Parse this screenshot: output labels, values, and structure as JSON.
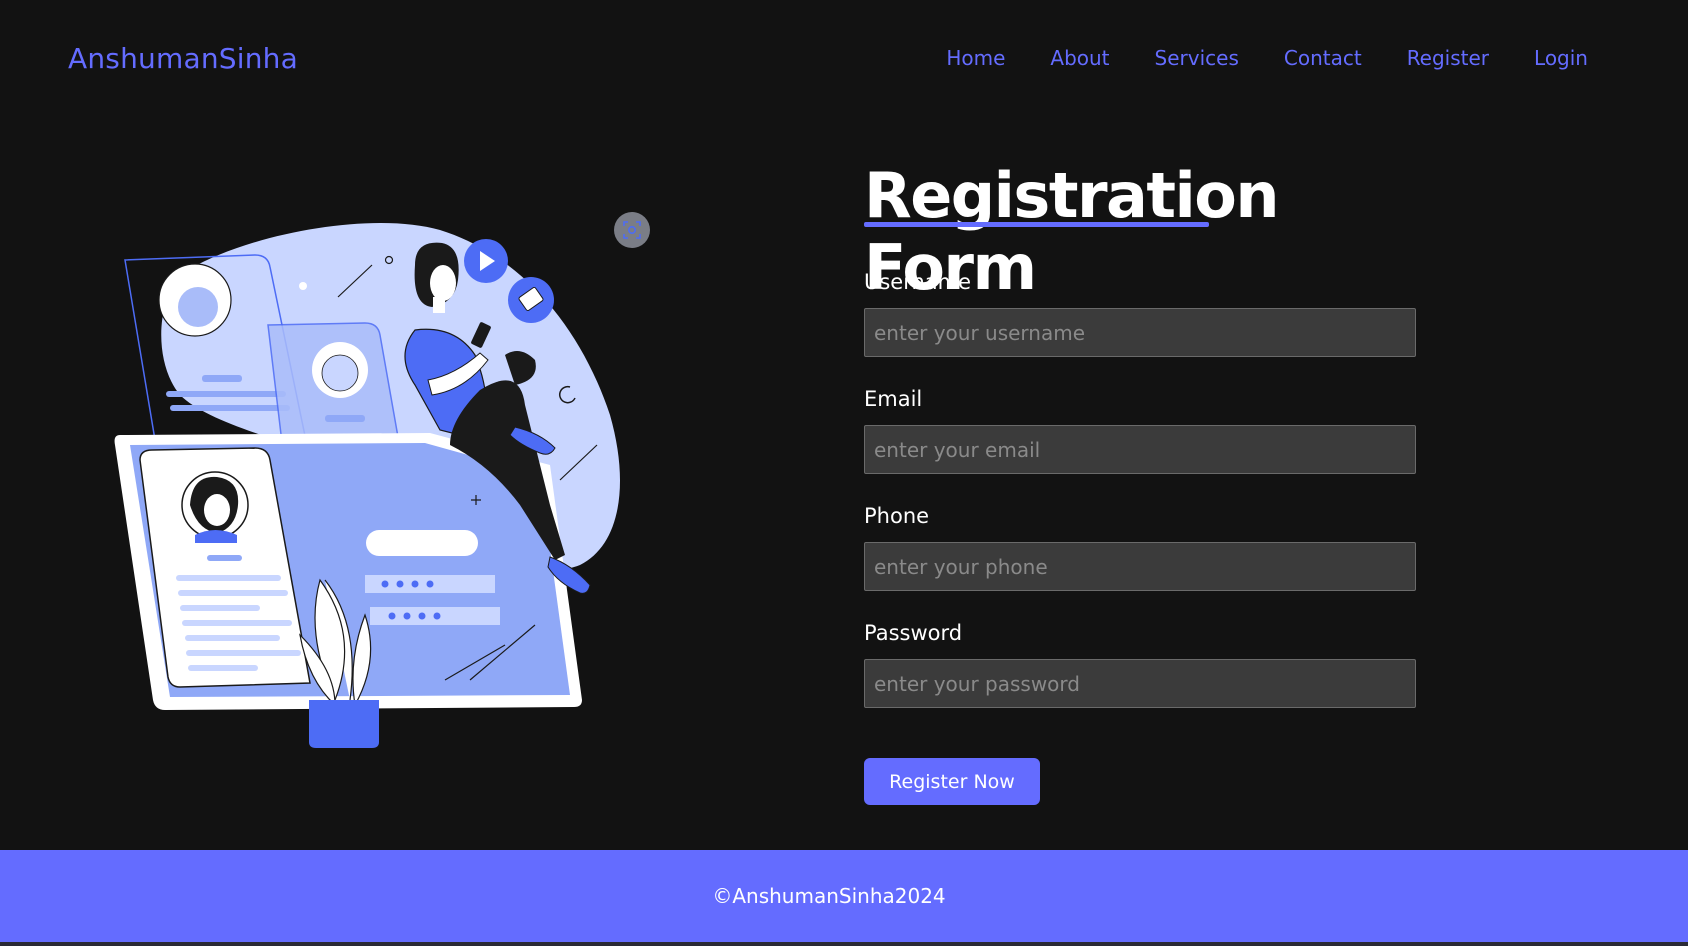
{
  "header": {
    "logo": "AnshumanSinha",
    "nav": [
      "Home",
      "About",
      "Services",
      "Contact",
      "Register",
      "Login"
    ]
  },
  "form": {
    "title": "Registration Form",
    "fields": [
      {
        "label": "Username",
        "placeholder": "enter your username"
      },
      {
        "label": "Email",
        "placeholder": "enter your email"
      },
      {
        "label": "Phone",
        "placeholder": "enter your phone"
      },
      {
        "label": "Password",
        "placeholder": "enter your password"
      }
    ],
    "submit_label": "Register Now"
  },
  "footer": {
    "text": "©AnshumanSinha2024"
  },
  "colors": {
    "accent": "#646cff",
    "background": "#121212",
    "input_bg": "#3b3b3b",
    "illustration_light": "#c9d6ff",
    "illustration_mid": "#8fa8f7",
    "illustration_strong": "#4d6cf5"
  },
  "icons": {
    "scan": "scan-icon",
    "play": "play-icon",
    "mail": "mail-icon"
  }
}
